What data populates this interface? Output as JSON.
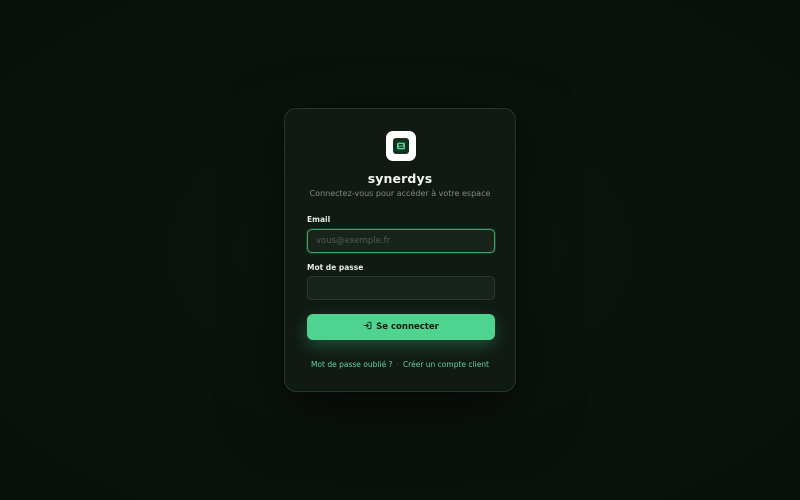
{
  "brand": {
    "name": "synerdys",
    "logo_icon": "synerdys-logo-icon",
    "accent_color": "#4ed48e"
  },
  "login": {
    "subtitle": "Connectez-vous pour accéder à votre espace",
    "email_label": "Email",
    "email_placeholder": "vous@exemple.fr",
    "email_value": "",
    "password_label": "Mot de passe",
    "password_value": "",
    "submit_label": "Se connecter",
    "submit_icon": "login-icon",
    "forgot_password_link": "Mot de passe oublié ?",
    "separator": "·",
    "create_account_link": "Créer un compte client"
  }
}
